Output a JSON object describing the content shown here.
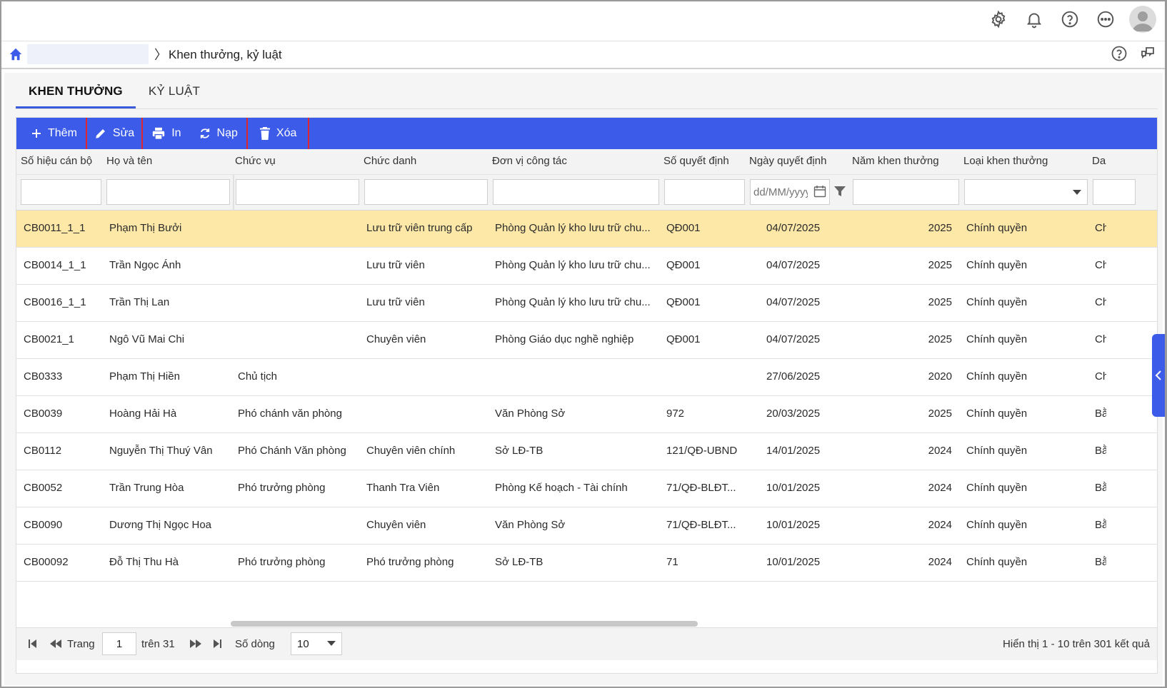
{
  "breadcrumb": {
    "separator": "〉",
    "current": "Khen thưởng, kỷ luật"
  },
  "tabs": [
    {
      "label": "KHEN THƯỞNG",
      "active": true
    },
    {
      "label": "KỶ LUẬT",
      "active": false
    }
  ],
  "toolbar": {
    "add": "Thêm",
    "edit": "Sửa",
    "print": "In",
    "reload": "Nạp",
    "delete": "Xóa"
  },
  "columns": {
    "code": "Số hiệu cán bộ",
    "name": "Họ và tên",
    "position": "Chức vụ",
    "title": "Chức danh",
    "unit": "Đơn vị công tác",
    "decision_no": "Số quyết định",
    "decision_date": "Ngày quyết định",
    "year": "Năm khen thưởng",
    "type": "Loại khen thưởng",
    "extra": "Da"
  },
  "filters": {
    "date_placeholder": "dd/MM/yyyy"
  },
  "rows": [
    {
      "code": "CB0011_1_1",
      "name": "Phạm Thị Bưởi",
      "position": "",
      "title": "Lưu trữ viên trung cấp",
      "unit": "Phòng Quản lý kho lưu trữ chu...",
      "decision_no": "QĐ001",
      "decision_date": "04/07/2025",
      "year": "2025",
      "type": "Chính quyền",
      "extra": "Ch"
    },
    {
      "code": "CB0014_1_1",
      "name": "Trần Ngọc Ánh",
      "position": "",
      "title": "Lưu trữ viên",
      "unit": "Phòng Quản lý kho lưu trữ chu...",
      "decision_no": "QĐ001",
      "decision_date": "04/07/2025",
      "year": "2025",
      "type": "Chính quyền",
      "extra": "Ch"
    },
    {
      "code": "CB0016_1_1",
      "name": "Trần Thị Lan",
      "position": "",
      "title": "Lưu trữ viên",
      "unit": "Phòng Quản lý kho lưu trữ chu...",
      "decision_no": "QĐ001",
      "decision_date": "04/07/2025",
      "year": "2025",
      "type": "Chính quyền",
      "extra": "Ch"
    },
    {
      "code": "CB0021_1",
      "name": "Ngô Vũ Mai Chi",
      "position": "",
      "title": "Chuyên viên",
      "unit": "Phòng Giáo dục nghề nghiệp",
      "decision_no": "QĐ001",
      "decision_date": "04/07/2025",
      "year": "2025",
      "type": "Chính quyền",
      "extra": "Ch"
    },
    {
      "code": "CB0333",
      "name": "Phạm Thị Hiền",
      "position": "Chủ tịch",
      "title": "",
      "unit": "",
      "decision_no": "",
      "decision_date": "27/06/2025",
      "year": "2020",
      "type": "Chính quyền",
      "extra": "Ch"
    },
    {
      "code": "CB0039",
      "name": "Hoàng Hải Hà",
      "position": "Phó chánh văn phòng",
      "title": "",
      "unit": "Văn Phòng Sở",
      "decision_no": "972",
      "decision_date": "20/03/2025",
      "year": "2025",
      "type": "Chính quyền",
      "extra": "Bằ"
    },
    {
      "code": "CB0112",
      "name": "Nguyễn Thị Thuý Vân",
      "position": "Phó Chánh Văn phòng",
      "title": "Chuyên viên chính",
      "unit": "Sở LĐ-TB",
      "decision_no": "121/QĐ-UBND",
      "decision_date": "14/01/2025",
      "year": "2024",
      "type": "Chính quyền",
      "extra": "Bằ"
    },
    {
      "code": "CB0052",
      "name": "Trần Trung Hòa",
      "position": "Phó trưởng phòng",
      "title": "Thanh Tra Viên",
      "unit": "Phòng Kế hoạch - Tài chính",
      "decision_no": "71/QĐ-BLĐT...",
      "decision_date": "10/01/2025",
      "year": "2024",
      "type": "Chính quyền",
      "extra": "Bằ"
    },
    {
      "code": "CB0090",
      "name": "Dương Thị Ngọc Hoa",
      "position": "",
      "title": "Chuyên viên",
      "unit": "Văn Phòng Sở",
      "decision_no": "71/QĐ-BLĐT...",
      "decision_date": "10/01/2025",
      "year": "2024",
      "type": "Chính quyền",
      "extra": "Bằ"
    },
    {
      "code": "CB00092",
      "name": "Đỗ Thị Thu Hà",
      "position": "Phó trưởng phòng",
      "title": "Phó trưởng phòng",
      "unit": "Sở LĐ-TB",
      "decision_no": "71",
      "decision_date": "10/01/2025",
      "year": "2024",
      "type": "Chính quyền",
      "extra": "Bằ"
    }
  ],
  "pager": {
    "page_label": "Trang",
    "current_page": "1",
    "total_pages_label": "trên 31",
    "rows_label": "Số dòng",
    "rows_per_page": "10",
    "summary": "Hiển thị 1 - 10 trên 301 kết quả"
  },
  "colors": {
    "accent": "#3b5be8",
    "selected_row": "#fde8a8",
    "highlight_box": "#e0262c"
  }
}
